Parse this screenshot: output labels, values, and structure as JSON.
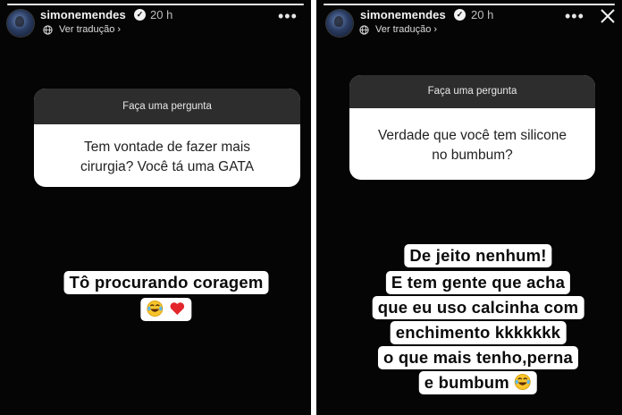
{
  "left_story": {
    "username": "simonemendes",
    "time": "20 h",
    "translate": "Ver tradução",
    "question_header": "Faça uma pergunta",
    "question_lines": [
      "Tem vontade de fazer mais",
      "cirurgia? Você tá uma GATA"
    ],
    "answer_lines": [
      "Tô procurando coragem"
    ],
    "answer_emojis": [
      "laughing-tears-emoji",
      "red-heart-emoji"
    ]
  },
  "right_story": {
    "username": "simonemendes",
    "time": "20 h",
    "translate": "Ver tradução",
    "question_header": "Faça uma pergunta",
    "question_lines": [
      "Verdade que você tem silicone",
      "no bumbum?"
    ],
    "answer_lines": [
      "De jeito nenhum!",
      "E tem gente que acha",
      "que eu uso calcinha com",
      "enchimento kkkkkkk",
      "o que mais tenho,perna",
      "e bumbum"
    ],
    "answer_emojis": [
      "laughing-tears-emoji"
    ]
  },
  "colors": {
    "story_bg": "#050505",
    "question_header_bg": "#2d2d2d",
    "sticker_bg": "#ffffff",
    "divider": "#ffffff"
  }
}
